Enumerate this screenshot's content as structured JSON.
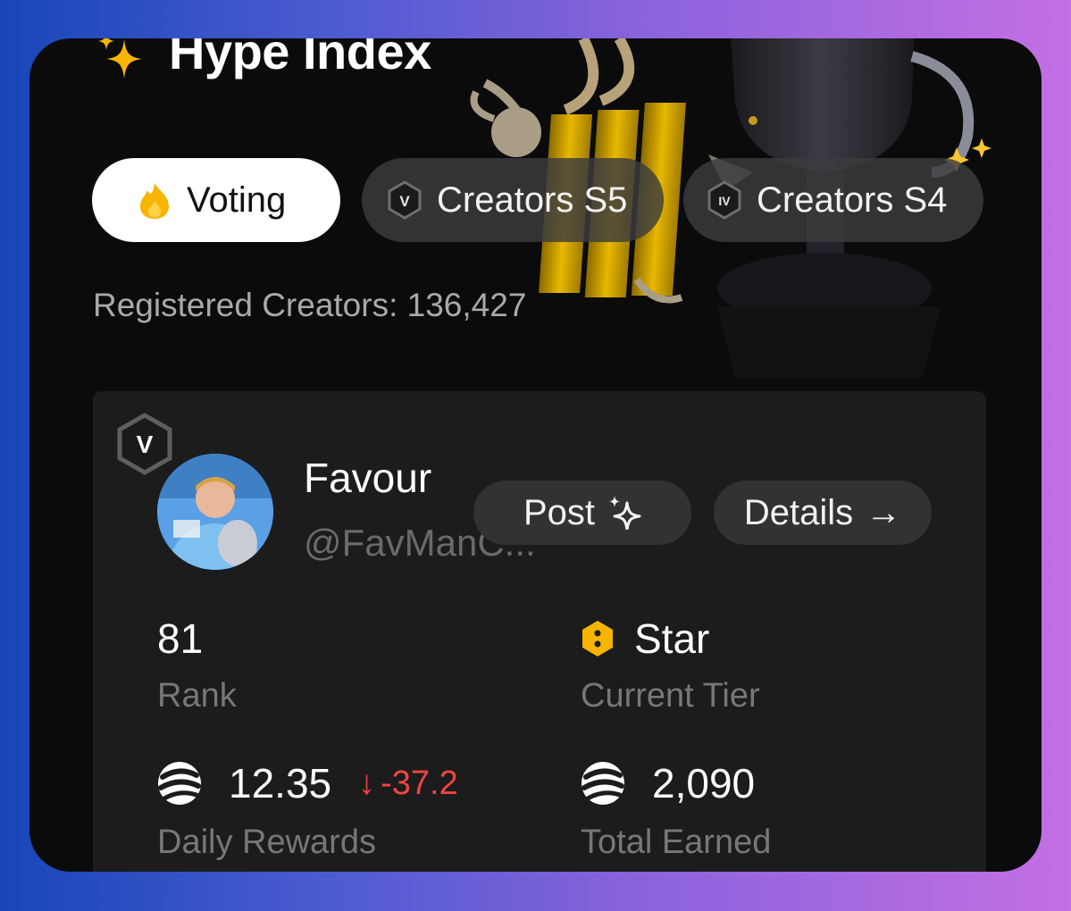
{
  "header": {
    "title": "Hype Index"
  },
  "tabs": [
    {
      "label": "Voting",
      "icon": "flame-icon",
      "active": true
    },
    {
      "label": "Creators S5",
      "icon": "tier-v-badge-icon",
      "badge": "V",
      "active": false
    },
    {
      "label": "Creators S4",
      "icon": "tier-iv-badge-icon",
      "badge": "IV",
      "active": false
    }
  ],
  "registered": "Registered Creators: 136,427",
  "profile": {
    "tier_badge": "V",
    "name": "Favour",
    "handle": "@FavManC...",
    "post_label": "Post",
    "details_label": "Details",
    "details_arrow": "→"
  },
  "stats": {
    "rank": {
      "value": "81",
      "label": "Rank"
    },
    "tier": {
      "value": "Star",
      "label": "Current Tier"
    },
    "daily": {
      "value": "12.35",
      "delta": "-37.2",
      "delta_arrow": "↓",
      "label": "Daily Rewards"
    },
    "total": {
      "value": "2,090",
      "label": "Total Earned"
    }
  },
  "colors": {
    "accent_yellow": "#f7b500",
    "negative": "#f04444",
    "card_bg": "#1c1c1d",
    "screen_bg": "#0b0b0c"
  }
}
